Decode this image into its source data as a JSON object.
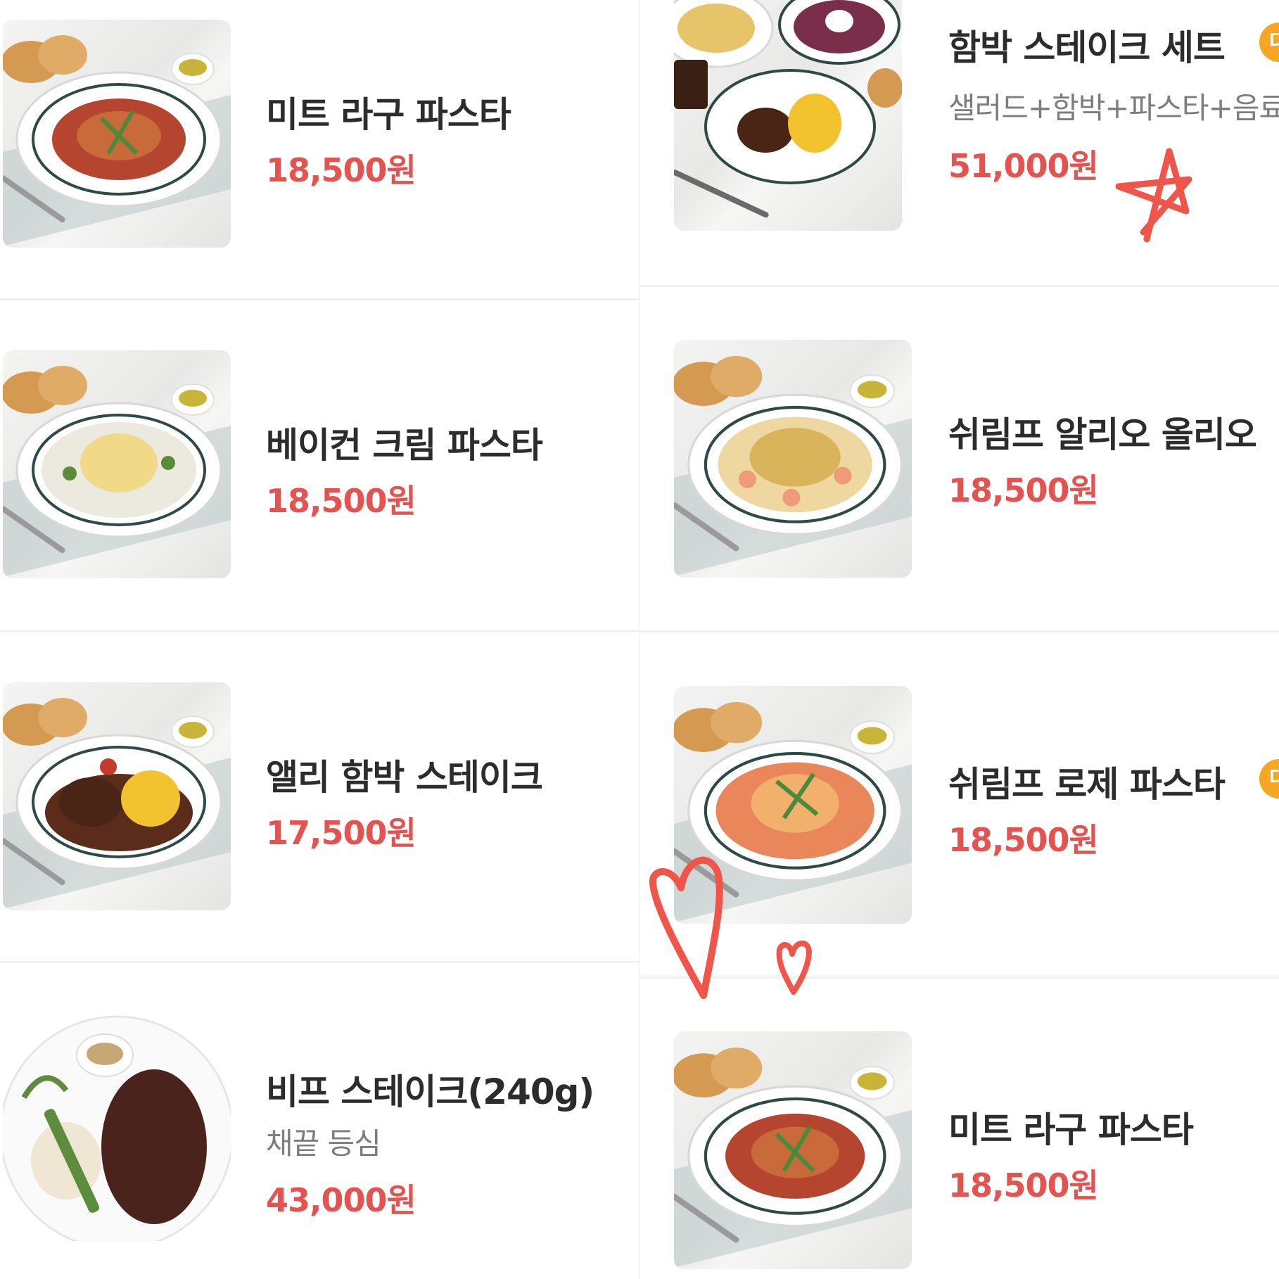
{
  "left_column": {
    "items": [
      {
        "name": "미트 라구 파스타",
        "price": "18,500원"
      },
      {
        "name": "베이컨 크림 파스타",
        "price": "18,500원"
      },
      {
        "name": "앨리 함박 스테이크",
        "price": "17,500원"
      },
      {
        "name": "비프 스테이크(240g)",
        "description": "채끝 등심",
        "price": "43,000원"
      }
    ]
  },
  "right_column": {
    "items": [
      {
        "name": "함박 스테이크 세트",
        "description": "샐러드+함박+파스타+음료",
        "price": "51,000원",
        "badge": "대"
      },
      {
        "name": "쉬림프 알리오 올리오",
        "price": "18,500원"
      },
      {
        "name": "쉬림프 로제 파스타",
        "price": "18,500원",
        "badge": "대"
      },
      {
        "name": "미트 라구 파스타",
        "price": "18,500원"
      }
    ]
  },
  "colors": {
    "price": "#e4534f",
    "badge": "#f5a623",
    "doodle": "#f0554a",
    "text": "#2c2c2c"
  },
  "annotations": [
    "star-doodle",
    "heart-doodle-large",
    "heart-doodle-small"
  ]
}
